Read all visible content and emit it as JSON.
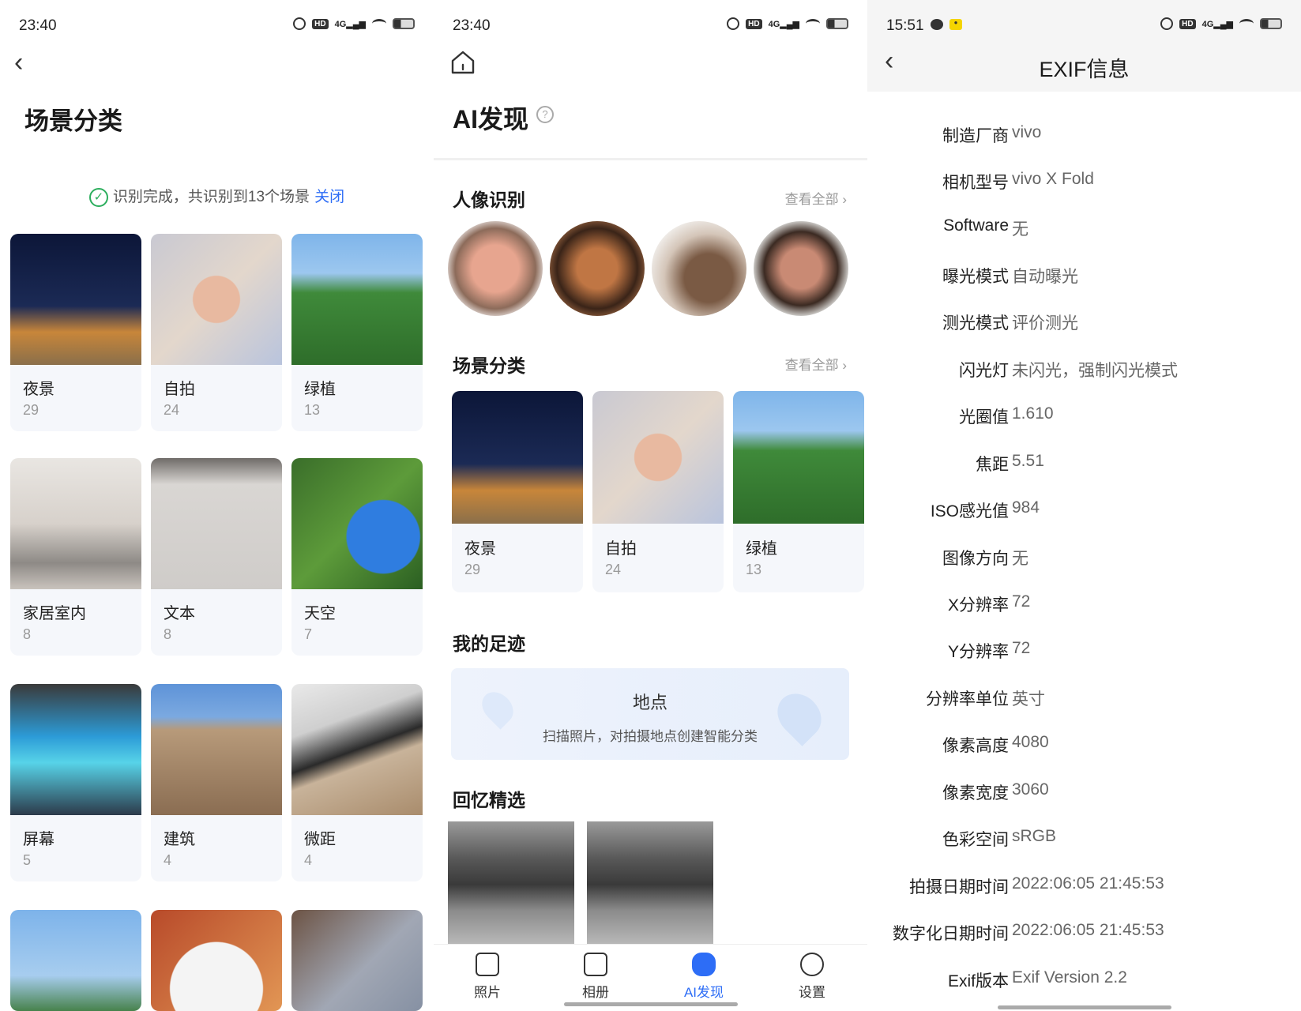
{
  "panel1": {
    "time": "23:40",
    "title": "场景分类",
    "notice": {
      "text": "识别完成，共识别到13个场景",
      "close": "关闭"
    },
    "cards": [
      {
        "name": "夜景",
        "count": "29"
      },
      {
        "name": "自拍",
        "count": "24"
      },
      {
        "name": "绿植",
        "count": "13"
      },
      {
        "name": "家居室内",
        "count": "8"
      },
      {
        "name": "文本",
        "count": "8"
      },
      {
        "name": "天空",
        "count": "7"
      },
      {
        "name": "屏幕",
        "count": "5"
      },
      {
        "name": "建筑",
        "count": "4"
      },
      {
        "name": "微距",
        "count": "4"
      }
    ]
  },
  "panel2": {
    "time": "23:40",
    "title": "AI发现",
    "faces_section": {
      "title": "人像识别",
      "view_all": "查看全部 ›"
    },
    "scenes_section": {
      "title": "场景分类",
      "view_all": "查看全部 ›",
      "cards": [
        {
          "name": "夜景",
          "count": "29"
        },
        {
          "name": "自拍",
          "count": "24"
        },
        {
          "name": "绿植",
          "count": "13"
        }
      ]
    },
    "footprint": {
      "title": "我的足迹",
      "box_title": "地点",
      "box_subtitle": "扫描照片，对拍摄地点创建智能分类"
    },
    "memories": {
      "title": "回忆精选"
    },
    "tabs": [
      {
        "label": "照片",
        "icon": "photo-icon"
      },
      {
        "label": "相册",
        "icon": "album-icon"
      },
      {
        "label": "AI发现",
        "icon": "robot-icon"
      },
      {
        "label": "设置",
        "icon": "gear-icon"
      }
    ],
    "active_tab": "AI发现",
    "accent": "#2d6df6"
  },
  "panel3": {
    "time": "15:51",
    "title": "EXIF信息",
    "rows": [
      {
        "k": "制造厂商",
        "v": "vivo"
      },
      {
        "k": "相机型号",
        "v": "vivo X Fold"
      },
      {
        "k": "Software",
        "v": "无"
      },
      {
        "k": "曝光模式",
        "v": "自动曝光"
      },
      {
        "k": "测光模式",
        "v": "评价测光"
      },
      {
        "k": "闪光灯",
        "v": "未闪光，强制闪光模式"
      },
      {
        "k": "光圈值",
        "v": "1.610"
      },
      {
        "k": "焦距",
        "v": "5.51"
      },
      {
        "k": "ISO感光值",
        "v": "984"
      },
      {
        "k": "图像方向",
        "v": "无"
      },
      {
        "k": "X分辨率",
        "v": "72"
      },
      {
        "k": "Y分辨率",
        "v": "72"
      },
      {
        "k": "分辨率单位",
        "v": "英寸"
      },
      {
        "k": "像素高度",
        "v": "4080"
      },
      {
        "k": "像素宽度",
        "v": "3060"
      },
      {
        "k": "色彩空间",
        "v": "sRGB"
      },
      {
        "k": "拍摄日期时间",
        "v": "2022:06:05 21:45:53"
      },
      {
        "k": "数字化日期时间",
        "v": "2022:06:05 21:45:53"
      },
      {
        "k": "Exif版本",
        "v": "Exif Version 2.2"
      }
    ]
  }
}
